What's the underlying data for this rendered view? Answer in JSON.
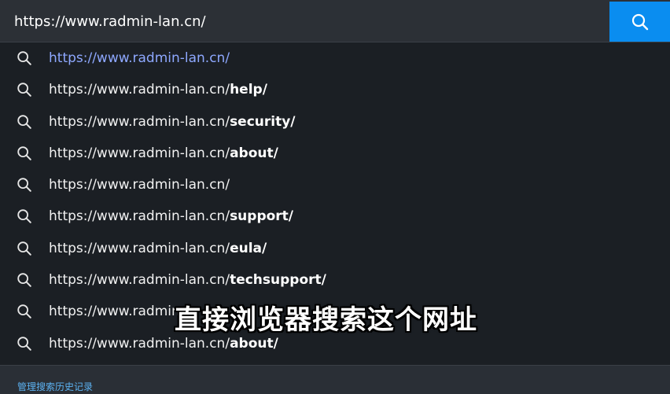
{
  "search_bar": {
    "value": "https://www.radmin-lan.cn/",
    "button_icon": "search-icon"
  },
  "colors": {
    "accent": "#0a8df0",
    "highlight_text": "#8ea8ff",
    "footer_link": "#5cb2f2"
  },
  "suggestions": [
    {
      "base": "https://www.radmin-lan.cn/",
      "suffix": "",
      "icon": "search-icon"
    },
    {
      "base": "https://www.radmin-lan.cn/",
      "suffix": "help/",
      "icon": "search-icon"
    },
    {
      "base": "https://www.radmin-lan.cn/",
      "suffix": "security/",
      "icon": "search-icon"
    },
    {
      "base": "https://www.radmin-lan.cn/",
      "suffix": "about/",
      "icon": "search-icon"
    },
    {
      "base": "https://www.radmin-lan.cn/",
      "suffix": "",
      "icon": "search-icon"
    },
    {
      "base": "https://www.radmin-lan.cn/",
      "suffix": "support/",
      "icon": "search-icon"
    },
    {
      "base": "https://www.radmin-lan.cn/",
      "suffix": "eula/",
      "icon": "search-icon"
    },
    {
      "base": "https://www.radmin-lan.cn/",
      "suffix": "techsupport/",
      "icon": "search-icon"
    },
    {
      "base": "https://www.radmin-",
      "suffix": "",
      "icon": "search-icon"
    },
    {
      "base": "https://www.radmin-lan.cn/",
      "suffix": "about/",
      "icon": "search-icon"
    }
  ],
  "footer": {
    "manage_history": "管理搜索历史记录"
  },
  "overlay": {
    "caption": "直接浏览器搜索这个网址"
  }
}
